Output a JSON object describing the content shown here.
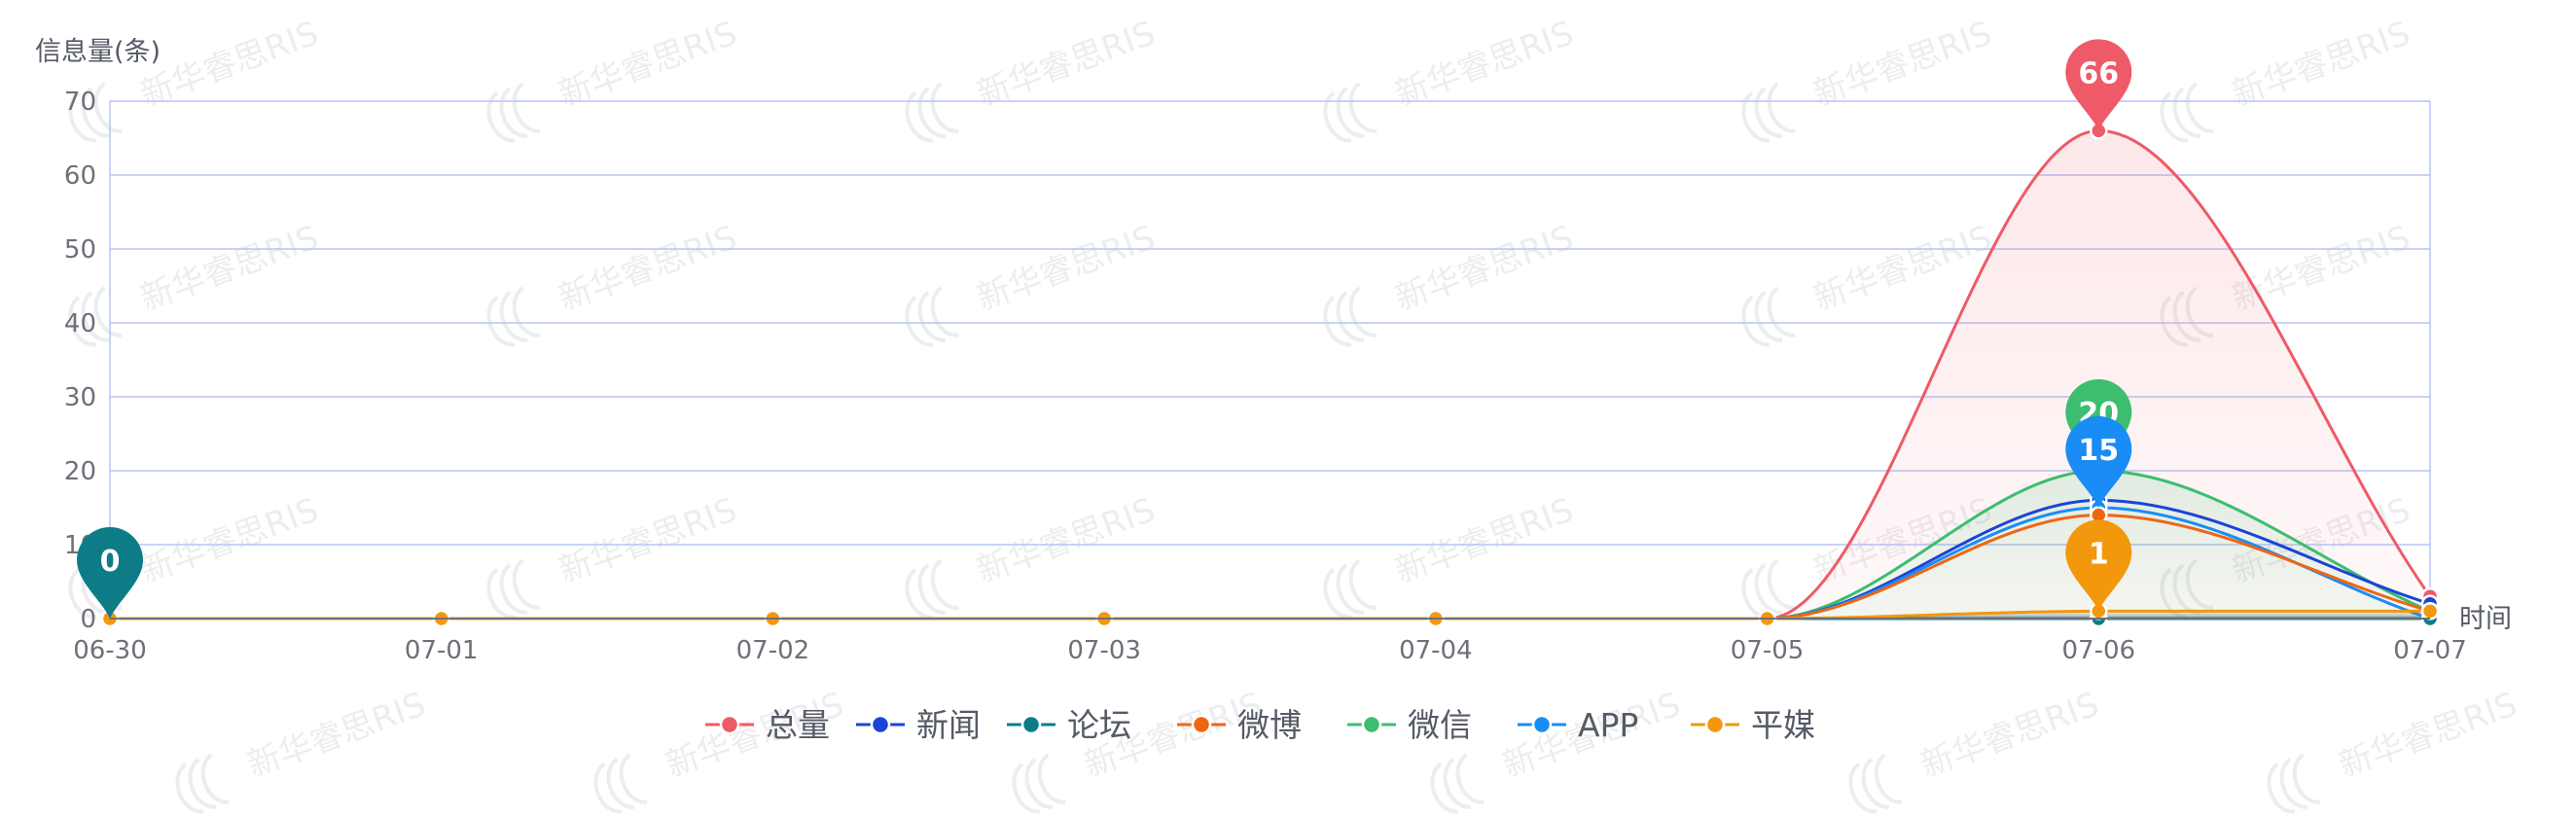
{
  "chart_data": {
    "type": "line",
    "title": "",
    "ylabel": "信息量(条)",
    "xlabel": "时间",
    "ylim": [
      0,
      70
    ],
    "yticks": [
      0,
      10,
      20,
      30,
      40,
      50,
      60,
      70
    ],
    "categories": [
      "06-30",
      "07-01",
      "07-02",
      "07-03",
      "07-04",
      "07-05",
      "07-06",
      "07-07"
    ],
    "grid": true,
    "legend_position": "bottom-center",
    "series": [
      {
        "name": "总量",
        "color": "#ee5a67",
        "values": [
          0,
          0,
          0,
          0,
          0,
          0,
          66,
          3
        ],
        "area": true
      },
      {
        "name": "新闻",
        "color": "#1b44d6",
        "values": [
          0,
          0,
          0,
          0,
          0,
          0,
          16,
          2
        ],
        "area": false
      },
      {
        "name": "论坛",
        "color": "#0e7c86",
        "values": [
          0,
          0,
          0,
          0,
          0,
          0,
          0,
          0
        ],
        "area": false
      },
      {
        "name": "微博",
        "color": "#ee6614",
        "values": [
          0,
          0,
          0,
          0,
          0,
          0,
          14,
          1
        ],
        "area": false
      },
      {
        "name": "微信",
        "color": "#3cbd6f",
        "values": [
          0,
          0,
          0,
          0,
          0,
          0,
          20,
          1
        ],
        "area": true
      },
      {
        "name": "APP",
        "color": "#1a8cf5",
        "values": [
          0,
          0,
          0,
          0,
          0,
          0,
          15,
          0
        ],
        "area": false
      },
      {
        "name": "平媒",
        "color": "#f3980c",
        "values": [
          0,
          0,
          0,
          0,
          0,
          0,
          1,
          1
        ],
        "area": true
      }
    ],
    "markers": [
      {
        "series": "论坛",
        "index": 0,
        "label": "0"
      },
      {
        "series": "总量",
        "index": 6,
        "label": "66"
      },
      {
        "series": "微信",
        "index": 6,
        "label": "20"
      },
      {
        "series": "APP",
        "index": 6,
        "label": "15"
      },
      {
        "series": "平媒",
        "index": 6,
        "label": "1"
      }
    ]
  },
  "watermark": {
    "text": "新华睿思RIS"
  }
}
